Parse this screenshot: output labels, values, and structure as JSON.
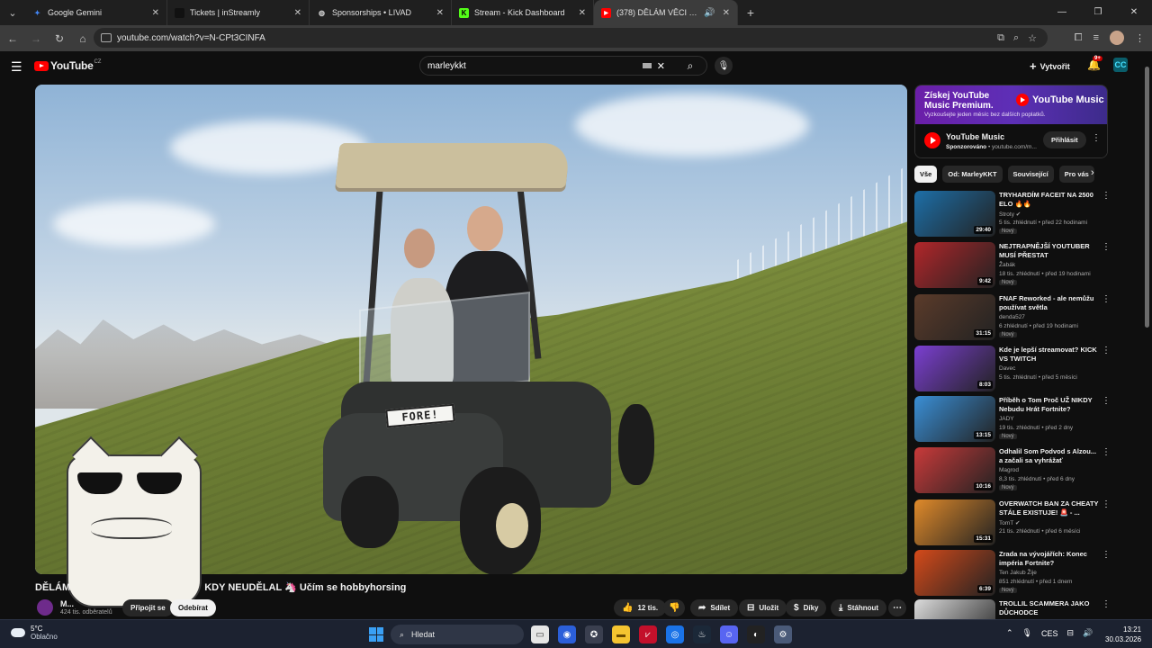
{
  "browser": {
    "tabs": [
      {
        "title": "Google Gemini",
        "fav_color": "#4285f4",
        "fav_glyph": "✦"
      },
      {
        "title": "Tickets | inStreamly",
        "fav_color": "#111111",
        "fav_glyph": ""
      },
      {
        "title": "Sponsorships • LIVAD",
        "fav_color": "#2a2a2a",
        "fav_glyph": "◍"
      },
      {
        "title": "Stream - Kick Dashboard",
        "fav_color": "#53fc18",
        "fav_glyph": "K"
      },
      {
        "title": "(378) DĚLÁM VĚCI CO BYCH",
        "fav_color": "#ff0000",
        "fav_glyph": "▶"
      }
    ],
    "url": "youtube.com/watch?v=N-CPt3CINFA"
  },
  "youtube": {
    "logo_text": "YouTube",
    "logo_country": "CZ",
    "search_value": "marleykkt",
    "create_label": "Vytvořit",
    "notif_count": "9+",
    "channel_initials": "CC"
  },
  "video": {
    "title_start": "DĚLÁM",
    "title_end": "KDY NEUDĚLAL 🦄 Učím se hobbyhorsing",
    "cart_sign": "FORE!",
    "channel_name": "M...",
    "subscribers": "424 tis. odběratelů",
    "join_label": "Připojit se",
    "subscribe_label": "Odebírat",
    "likes": "12 tis.",
    "share_label": "Sdílet",
    "save_label": "Uložit",
    "thanks_label": "Díky",
    "download_label": "Stáhnout"
  },
  "ad": {
    "headline": "Získej YouTube Music Premium.",
    "subline": "Vyzkoušejte jeden měsíc bez dalších poplatků.",
    "brand": "YouTube Music",
    "advertiser": "YouTube Music",
    "sponsored": "Sponzorováno",
    "domain": " • youtube.com/m...",
    "cta": "Přihlásit"
  },
  "chips": [
    "Vše",
    "Od: MarleyKKT",
    "Související",
    "Pro vás"
  ],
  "recommendations": [
    {
      "title": "TRYHARDÍM FACEIT NA 2500 ELO 🔥🔥",
      "channel": "Stroty ✔",
      "meta": "5 tis. zhlédnutí • před 22 hodinami",
      "badge": "Nový",
      "duration": "29:40",
      "color": "#1d6fa8"
    },
    {
      "title": "NEJTRAPNĚJŠÍ YOUTUBER MUSÍ PŘESTAT",
      "channel": "Žabák",
      "meta": "18 tis. zhlédnutí • před 19 hodinami",
      "badge": "Nový",
      "duration": "9:42",
      "color": "#b1262a"
    },
    {
      "title": "FNAF Reworked - ale nemůžu používat světla",
      "channel": "denda527",
      "meta": "6 zhlédnutí • před 19 hodinami",
      "badge": "Nový",
      "duration": "31:15",
      "color": "#5b3b2a"
    },
    {
      "title": "Kde je lepší streamovat? KICK VS TWITCH",
      "channel": "Davec",
      "meta": "5 tis. zhlédnutí • před 5 měsíci",
      "badge": "",
      "duration": "8:03",
      "color": "#7b3fd1"
    },
    {
      "title": "Příběh o Tom Proč UŽ NIKDY Nebudu Hrát Fortnite?",
      "channel": "JADY",
      "meta": "19 tis. zhlédnutí • před 2 dny",
      "badge": "Nový",
      "duration": "13:15",
      "color": "#3a8fd6"
    },
    {
      "title": "Odhalil Som Podvod s Alzou... a začali sa vyhrážať",
      "channel": "Magrod",
      "meta": "8,3 tis. zhlédnutí • před 6 dny",
      "badge": "Nový",
      "duration": "10:16",
      "color": "#c93a3a"
    },
    {
      "title": "OVERWATCH BAN ZA CHEATY STÁLE EXISTUJE! 🚨 - ...",
      "channel": "TomT ✔",
      "meta": "21 tis. zhlédnutí • před 6 měsíci",
      "badge": "",
      "duration": "15:31",
      "color": "#e08a2a"
    },
    {
      "title": "Zrada na vývojářích: Konec impéria Fortnite?",
      "channel": "Ten Jakub Žije",
      "meta": "851 zhlédnutí • před 1 dnem",
      "badge": "Nový",
      "duration": "6:39",
      "color": "#d44a1a"
    },
    {
      "title": "TROLLIL SCAMMERA JAKO DŮCHODCE",
      "channel": "",
      "meta": "",
      "badge": "",
      "duration": "",
      "color": "#dcdcdc"
    }
  ],
  "taskbar": {
    "temp": "5°C",
    "weather": "Oblačno",
    "search_label": "Hledat",
    "lang": "CES",
    "time": "13:21",
    "date": "30.03.2026"
  }
}
